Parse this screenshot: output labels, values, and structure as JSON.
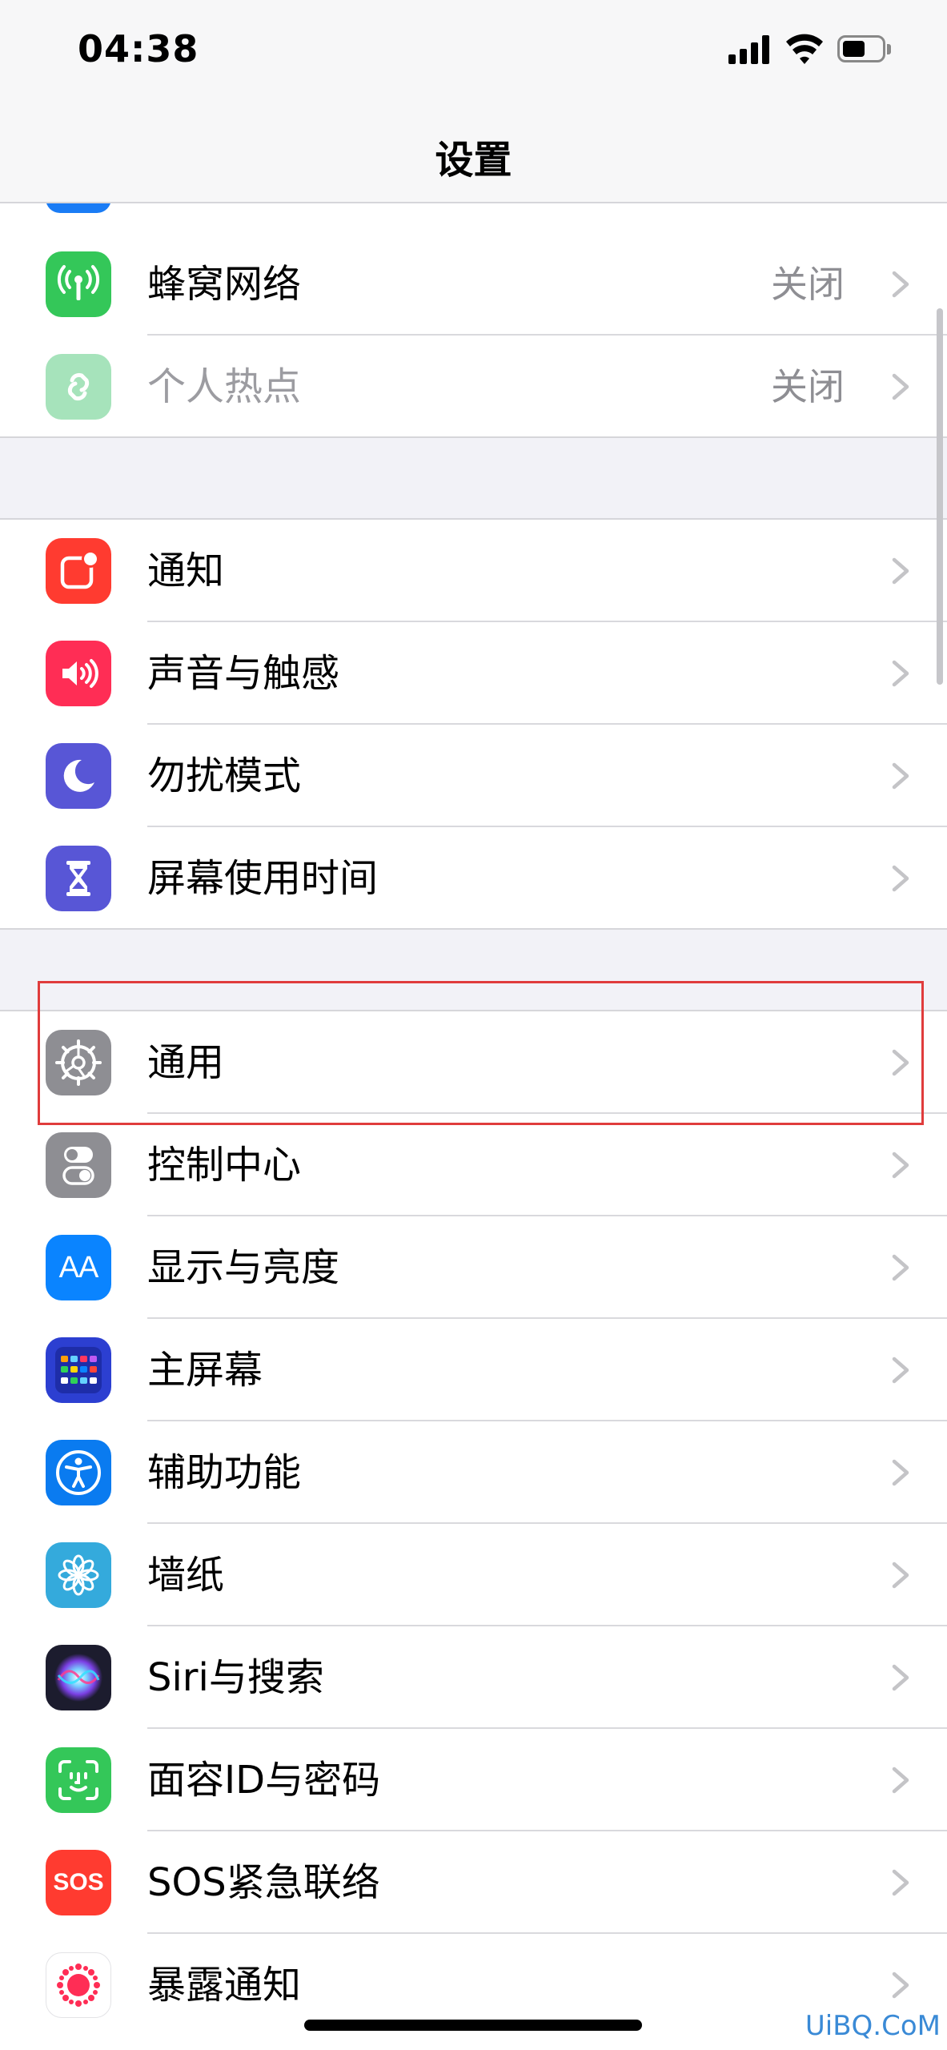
{
  "status_bar": {
    "time": "04:38"
  },
  "nav": {
    "title": "设置"
  },
  "rows": {
    "cellular": {
      "label": "蜂窝网络",
      "value": "关闭",
      "icon": "antenna-icon",
      "color": "#34c759"
    },
    "hotspot": {
      "label": "个人热点",
      "value": "关闭",
      "icon": "hotspot-link-icon",
      "color": "#a6e3bb"
    },
    "notifications": {
      "label": "通知",
      "icon": "notification-badge-icon",
      "color": "#ff3b30"
    },
    "sounds": {
      "label": "声音与触感",
      "icon": "speaker-icon",
      "color": "#ff2d55"
    },
    "dnd": {
      "label": "勿扰模式",
      "icon": "moon-icon",
      "color": "#5856d6"
    },
    "screentime": {
      "label": "屏幕使用时间",
      "icon": "hourglass-icon",
      "color": "#5856d6"
    },
    "general": {
      "label": "通用",
      "icon": "gear-icon",
      "color": "#8e8e93"
    },
    "control": {
      "label": "控制中心",
      "icon": "toggle-switches-icon",
      "color": "#8e8e93"
    },
    "display": {
      "label": "显示与亮度",
      "icon": "text-size-icon",
      "icon_text": "AA",
      "color": "#0a84ff"
    },
    "homescreen": {
      "label": "主屏幕",
      "icon": "app-grid-icon",
      "color": "#2c3fd1"
    },
    "accessibility": {
      "label": "辅助功能",
      "icon": "accessibility-icon",
      "color": "#0a7bf0"
    },
    "wallpaper": {
      "label": "墙纸",
      "icon": "flower-icon",
      "color": "#34aadc"
    },
    "siri": {
      "label": "Siri与搜索",
      "icon": "siri-orb-icon",
      "color": "#1c1c2e"
    },
    "faceid": {
      "label": "面容ID与密码",
      "icon": "face-id-icon",
      "color": "#34c759"
    },
    "sos": {
      "label": "SOS紧急联络",
      "icon": "sos-icon",
      "icon_text": "SOS",
      "color": "#ff3b30"
    },
    "exposure": {
      "label": "暴露通知",
      "icon": "exposure-virus-icon",
      "color": "#ffffff"
    }
  },
  "colors": {
    "chevron": "#c4c4c7",
    "highlight": "#e03c3c",
    "watermark": "#3a8ad6"
  },
  "watermark": "UiBQ.CoM"
}
